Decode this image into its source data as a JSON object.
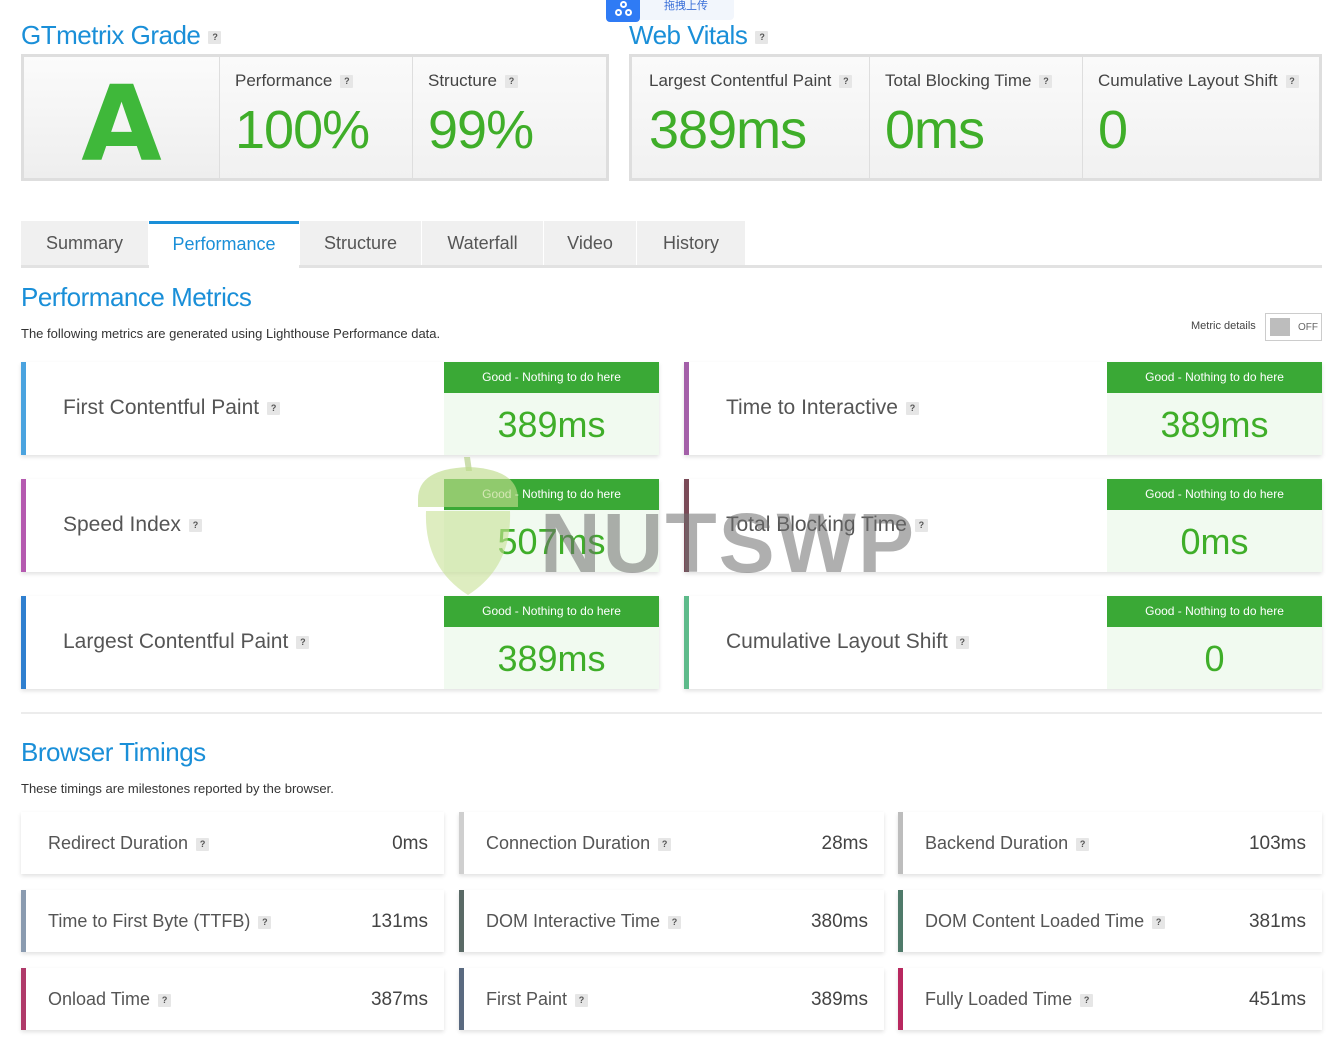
{
  "upload_badge": {
    "text": "拖拽上传"
  },
  "grade_section": {
    "title": "GTmetrix Grade",
    "help": "?",
    "grade": "A",
    "performance": {
      "label": "Performance",
      "value": "100%"
    },
    "structure": {
      "label": "Structure",
      "value": "99%"
    }
  },
  "web_vitals": {
    "title": "Web Vitals",
    "help": "?",
    "items": [
      {
        "label": "Largest Contentful Paint",
        "value": "389ms"
      },
      {
        "label": "Total Blocking Time",
        "value": "0ms"
      },
      {
        "label": "Cumulative Layout Shift",
        "value": "0"
      }
    ]
  },
  "tabs": [
    {
      "label": "Summary",
      "active": false
    },
    {
      "label": "Performance",
      "active": true
    },
    {
      "label": "Structure",
      "active": false
    },
    {
      "label": "Waterfall",
      "active": false
    },
    {
      "label": "Video",
      "active": false
    },
    {
      "label": "History",
      "active": false
    }
  ],
  "performance_metrics": {
    "title": "Performance Metrics",
    "description": "The following metrics are generated using Lighthouse Performance data.",
    "toggle_label": "Metric details",
    "toggle_state": "OFF",
    "cards": [
      {
        "label": "First Contentful Paint",
        "badge": "Good - Nothing to do here",
        "value": "389ms",
        "color": "#4aa3df"
      },
      {
        "label": "Time to Interactive",
        "badge": "Good - Nothing to do here",
        "value": "389ms",
        "color": "#a35fa8"
      },
      {
        "label": "Speed Index",
        "badge": "Good - Nothing to do here",
        "value": "507ms",
        "color": "#b55ab0"
      },
      {
        "label": "Total Blocking Time",
        "badge": "Good - Nothing to do here",
        "value": "0ms",
        "color": "#7a4a57"
      },
      {
        "label": "Largest Contentful Paint",
        "badge": "Good - Nothing to do here",
        "value": "389ms",
        "color": "#2f7fcf"
      },
      {
        "label": "Cumulative Layout Shift",
        "badge": "Good - Nothing to do here",
        "value": "0",
        "color": "#5dba8a"
      }
    ]
  },
  "browser_timings": {
    "title": "Browser Timings",
    "description": "These timings are milestones reported by the browser.",
    "cards": [
      {
        "label": "Redirect Duration",
        "value": "0ms",
        "color": "#ffffff"
      },
      {
        "label": "Connection Duration",
        "value": "28ms",
        "color": "#cfcfcf"
      },
      {
        "label": "Backend Duration",
        "value": "103ms",
        "color": "#bdbdbd"
      },
      {
        "label": "Time to First Byte (TTFB)",
        "value": "131ms",
        "color": "#8a9bb0"
      },
      {
        "label": "DOM Interactive Time",
        "value": "380ms",
        "color": "#5a6a66"
      },
      {
        "label": "DOM Content Loaded Time",
        "value": "381ms",
        "color": "#4f7a6a"
      },
      {
        "label": "Onload Time",
        "value": "387ms",
        "color": "#b03a6a"
      },
      {
        "label": "First Paint",
        "value": "389ms",
        "color": "#5a6a80"
      },
      {
        "label": "Fully Loaded Time",
        "value": "451ms",
        "color": "#b8285f"
      }
    ]
  },
  "watermark": {
    "text": "NUTSWP"
  },
  "colors": {
    "accent": "#1a8fd8",
    "good": "#3fae29",
    "badge": "#3aa936"
  }
}
